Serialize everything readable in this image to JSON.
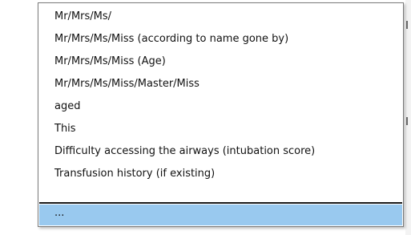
{
  "dropdown": {
    "items": [
      {
        "label": "Mr/Mrs/Ms/"
      },
      {
        "label": "Mr/Mrs/Ms/Miss (according to name gone by)"
      },
      {
        "label": "Mr/Mrs/Ms/Miss (Age)"
      },
      {
        "label": "Mr/Mrs/Ms/Miss/Master/Miss"
      },
      {
        "label": "aged"
      },
      {
        "label": "This"
      },
      {
        "label": "Difficulty accessing the airways (intubation score)"
      },
      {
        "label": "Transfusion history (if existing)"
      }
    ],
    "selected_item": {
      "label": "..."
    },
    "colors": {
      "highlight": "#99c9ef",
      "border": "#7a7a7a",
      "separator": "#1a1a1a"
    }
  }
}
